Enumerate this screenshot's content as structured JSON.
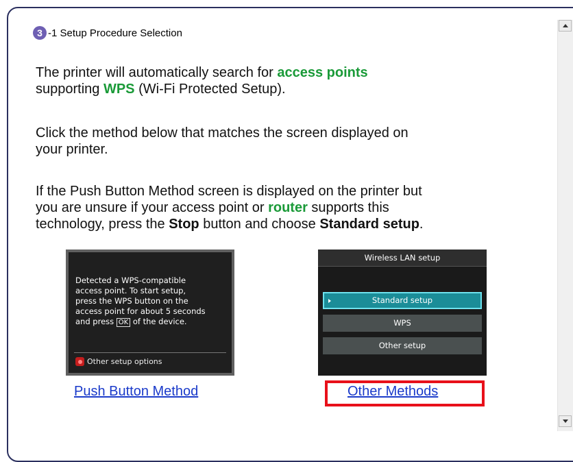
{
  "step": {
    "number": "3",
    "title": "-1 Setup Procedure Selection"
  },
  "intro": {
    "t1": "The printer will automatically search for ",
    "g1": "access points",
    "t2": "supporting ",
    "g2": "WPS",
    "t3": " (Wi-Fi Protected Setup)."
  },
  "instruction": {
    "line1": "Click the method below that matches the screen displayed on",
    "line2": "your printer."
  },
  "note": {
    "l1": "If the Push Button Method screen is displayed on the printer but",
    "l2a": "you are unsure if your access point or ",
    "l2g": "router",
    "l2b": " supports this",
    "l3a": "technology, press the ",
    "l3b1": "Stop",
    "l3c": " button and choose ",
    "l3b2": "Standard setup",
    "l3d": "."
  },
  "push_screen": {
    "l1": "Detected a WPS-compatible",
    "l2": "access point. To start setup,",
    "l3": "press the WPS button on the",
    "l4": "access point for about 5 seconds",
    "l5a": "and press ",
    "ok": "OK",
    "l5b": " of the device.",
    "footer": "Other setup options"
  },
  "wlan_screen": {
    "title": "Wireless LAN setup",
    "options": [
      "Standard setup",
      "WPS",
      "Other setup"
    ]
  },
  "links": {
    "push": "Push Button Method",
    "other": "Other Methods"
  },
  "colors": {
    "green": "#1a9a38",
    "link": "#1a3aca",
    "highlight": "#e8101a",
    "step_badge": "#6e5fb3"
  },
  "icons": {
    "scroll_up": "triangle-up",
    "scroll_down": "triangle-down",
    "red_button": "stop-button"
  }
}
